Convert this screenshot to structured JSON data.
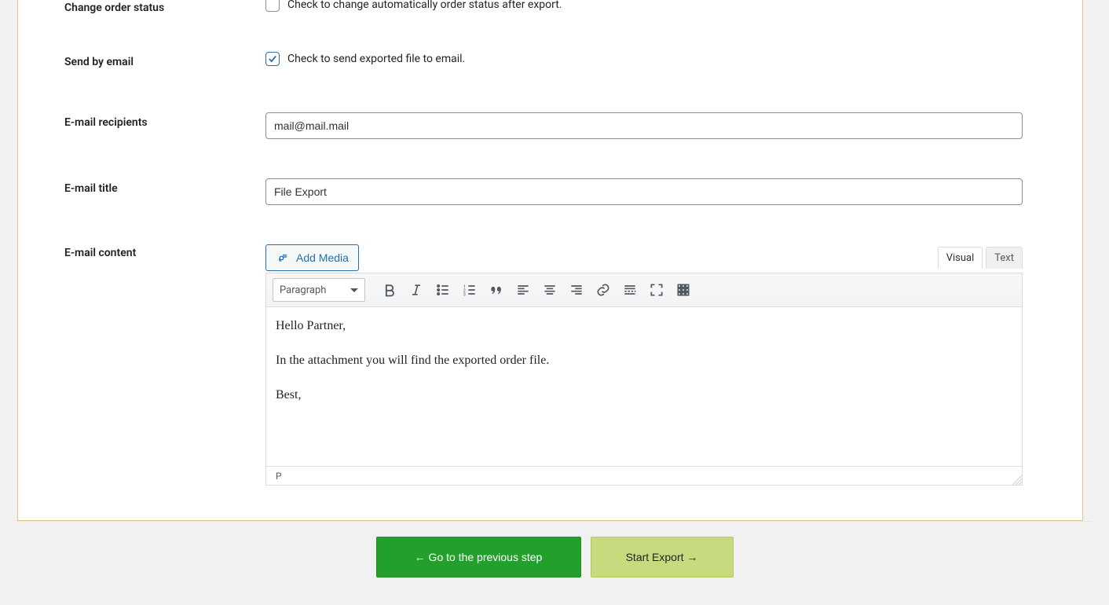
{
  "form": {
    "changeOrderStatus": {
      "label": "Change order status",
      "text": "Check to change automatically order status after export.",
      "checked": false
    },
    "sendByEmail": {
      "label": "Send by email",
      "text": "Check to send exported file to email.",
      "checked": true
    },
    "recipients": {
      "label": "E-mail recipients",
      "value": "mail@mail.mail"
    },
    "title": {
      "label": "E-mail title",
      "value": "File Export"
    },
    "content": {
      "label": "E-mail content"
    }
  },
  "editor": {
    "addMedia": "Add Media",
    "tabs": {
      "visual": "Visual",
      "text": "Text",
      "active": "visual"
    },
    "format": "Paragraph",
    "pathLabel": "P",
    "body": {
      "p1": "Hello Partner,",
      "p2": "In the attachment you will find the exported order file.",
      "p3": "Best,"
    }
  },
  "nav": {
    "prev": "← Go to the previous step",
    "next": "Start Export →"
  }
}
